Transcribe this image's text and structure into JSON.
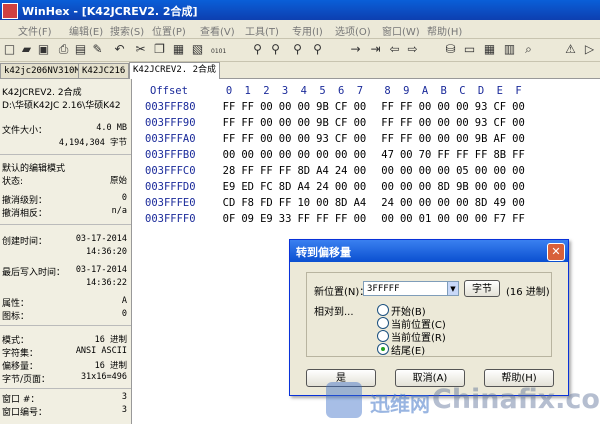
{
  "window": {
    "title": "WinHex - [K42JCREV2. 2合成]"
  },
  "menu": [
    "文件(F)",
    "编辑(E)",
    "搜索(S)",
    "位置(P)",
    "查看(V)",
    "工具(T)",
    "专用(I)",
    "选项(O)",
    "窗口(W)",
    "帮助(H)"
  ],
  "tabs": [
    "k42jc206NV310M",
    "K42JC216",
    "K42JCREV2. 2合成"
  ],
  "info": {
    "filename": "K42JCREV2. 2合成",
    "path": "D:\\华硕K42JC 2.16\\华硕K42",
    "filesize_label": "文件大小：",
    "filesize_mb": "4.0 MB",
    "filesize_bytes": "4,194,304 字节",
    "edit_mode_label": "默认的编辑模式",
    "state_label": "状态:",
    "state_value": "原始",
    "undo_level_label": "撤消级别：",
    "undo_level_value": "0",
    "undo_reverse_label": "撤消相反：",
    "undo_reverse_value": "n/a",
    "created_label": "创建时间：",
    "created_date": "03-17-2014",
    "created_time": "14:36:20",
    "lastwrite_label": "最后写入时间：",
    "lastwrite_date": "03-17-2014",
    "lastwrite_time": "14:36:22",
    "attr_label": "属性：",
    "attr_value": "A",
    "icon_label": "图标：",
    "icon_value": "0",
    "mode_label": "模式：",
    "mode_value": "16 进制",
    "charset_label": "字符集：",
    "charset_value": "ANSI ASCII",
    "offsets_label": "偏移量：",
    "offsets_value": "16 进制",
    "bpp_label": "字节/页面：",
    "bpp_value": "31x16=496",
    "window_num_label": "窗口 #：",
    "window_num_value": "3",
    "window_no_label": "窗口编号：",
    "window_no_value": "3"
  },
  "hex": {
    "offset_header": "Offset",
    "columns": [
      "0",
      "1",
      "2",
      "3",
      "4",
      "5",
      "6",
      "7",
      "8",
      "9",
      "A",
      "B",
      "C",
      "D",
      "E",
      "F"
    ],
    "rows": [
      {
        "offset": "003FFF80",
        "bytes": [
          "FF",
          "FF",
          "00",
          "00",
          "00",
          "9B",
          "CF",
          "00",
          "FF",
          "FF",
          "00",
          "00",
          "00",
          "93",
          "CF",
          "00"
        ]
      },
      {
        "offset": "003FFF90",
        "bytes": [
          "FF",
          "FF",
          "00",
          "00",
          "00",
          "9B",
          "CF",
          "00",
          "FF",
          "FF",
          "00",
          "00",
          "00",
          "93",
          "CF",
          "00"
        ]
      },
      {
        "offset": "003FFFA0",
        "bytes": [
          "FF",
          "FF",
          "00",
          "00",
          "00",
          "93",
          "CF",
          "00",
          "FF",
          "FF",
          "00",
          "00",
          "00",
          "9B",
          "AF",
          "00"
        ]
      },
      {
        "offset": "003FFFB0",
        "bytes": [
          "00",
          "00",
          "00",
          "00",
          "00",
          "00",
          "00",
          "00",
          "47",
          "00",
          "70",
          "FF",
          "FF",
          "FF",
          "8B",
          "FF"
        ]
      },
      {
        "offset": "003FFFC0",
        "bytes": [
          "28",
          "FF",
          "FF",
          "FF",
          "8D",
          "A4",
          "24",
          "00",
          "00",
          "00",
          "00",
          "00",
          "05",
          "00",
          "00",
          "00"
        ]
      },
      {
        "offset": "003FFFD0",
        "bytes": [
          "E9",
          "ED",
          "FC",
          "8D",
          "A4",
          "24",
          "00",
          "00",
          "00",
          "00",
          "00",
          "8D",
          "9B",
          "00",
          "00",
          "00"
        ]
      },
      {
        "offset": "003FFFE0",
        "bytes": [
          "CD",
          "F8",
          "FD",
          "FF",
          "10",
          "00",
          "8D",
          "A4",
          "24",
          "00",
          "00",
          "00",
          "00",
          "8D",
          "49",
          "00"
        ]
      },
      {
        "offset": "003FFFF0",
        "bytes": [
          "0F",
          "09",
          "E9",
          "33",
          "FF",
          "FF",
          "FF",
          "00",
          "00",
          "00",
          "01",
          "00",
          "00",
          "00",
          "F7",
          "FF"
        ]
      }
    ]
  },
  "dialog": {
    "title": "转到偏移量",
    "new_pos_label": "新位置(N)：",
    "new_pos_value": "3FFFFF",
    "unit_button": "字节",
    "unit_note": "(16 进制)",
    "relative_label": "相对到...",
    "options": [
      "开始(B)",
      "当前位置(C)",
      "当前位置(R)",
      "结尾(E)"
    ],
    "selected": 3,
    "ok": "是",
    "cancel": "取消(A)",
    "help": "帮助(H)"
  },
  "watermark": {
    "cn": "迅维网",
    "en": "Chinafix.com"
  }
}
